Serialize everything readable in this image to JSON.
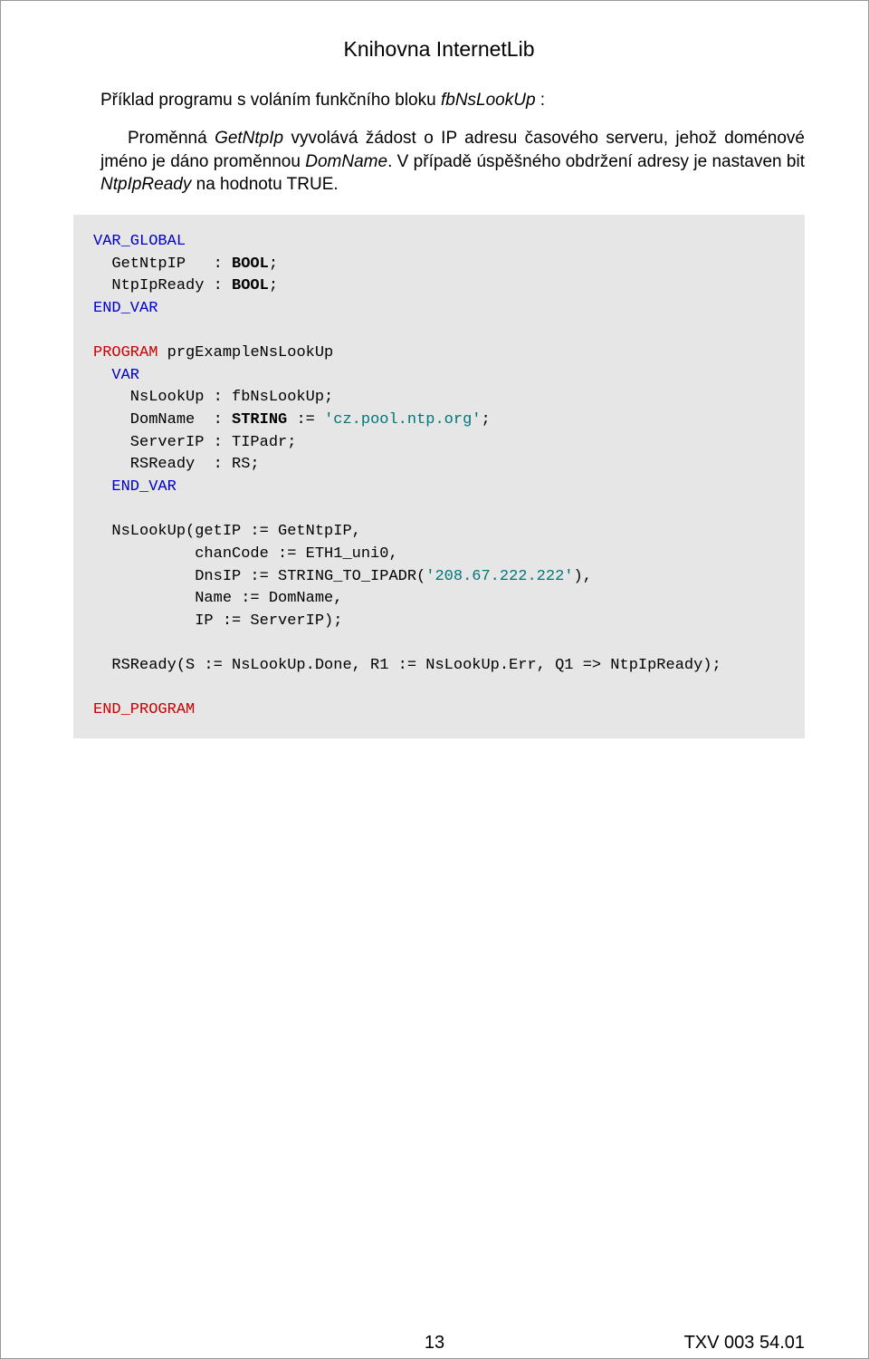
{
  "header": {
    "title": "Knihovna InternetLib"
  },
  "intro": {
    "prefix": "Příklad programu s voláním funkčního bloku ",
    "fn": "fbNsLookUp",
    "suffix": " :"
  },
  "paragraph": {
    "p1a": "Proměnná ",
    "v1": "GetNtpIp",
    "p1b": " vyvolává žádost o IP adresu časového serveru, jehož doménové jméno je dáno proměnnou ",
    "v2": "DomName",
    "p1c": ". V případě úspěšného obdržení adresy je nastaven bit ",
    "v3": "NtpIpReady",
    "p1d": " na hodnotu TRUE."
  },
  "code": {
    "l01a": "VAR_GLOBAL",
    "l02a": "  GetNtpIP   : ",
    "l02b": "BOOL",
    "l02c": ";",
    "l03a": "  NtpIpReady : ",
    "l03b": "BOOL",
    "l03c": ";",
    "l04a": "END_VAR",
    "l06a": "PROGRAM",
    "l06b": " prgExampleNsLookUp",
    "l07a": "  VAR",
    "l08a": "    NsLookUp : fbNsLookUp;",
    "l09a": "    DomName  : ",
    "l09b": "STRING",
    "l09c": " := ",
    "l09d": "'cz.pool.ntp.org'",
    "l09e": ";",
    "l10a": "    ServerIP : TIPadr;",
    "l11a": "    RSReady  : RS;",
    "l12a": "  END_VAR",
    "l14a": "  NsLookUp(getIP := GetNtpIP,",
    "l15a": "           chanCode := ETH1_uni0,",
    "l16a": "           DnsIP := STRING_TO_IPADR(",
    "l16b": "'208.67.222.222'",
    "l16c": "),",
    "l17a": "           Name := DomName,",
    "l18a": "           IP := ServerIP);",
    "l20a": "  RSReady(S := NsLookUp.Done, R1 := NsLookUp.Err, Q1 => NtpIpReady);",
    "l22a": "END_PROGRAM"
  },
  "footer": {
    "page": "13",
    "doc": "TXV 003 54.01"
  }
}
